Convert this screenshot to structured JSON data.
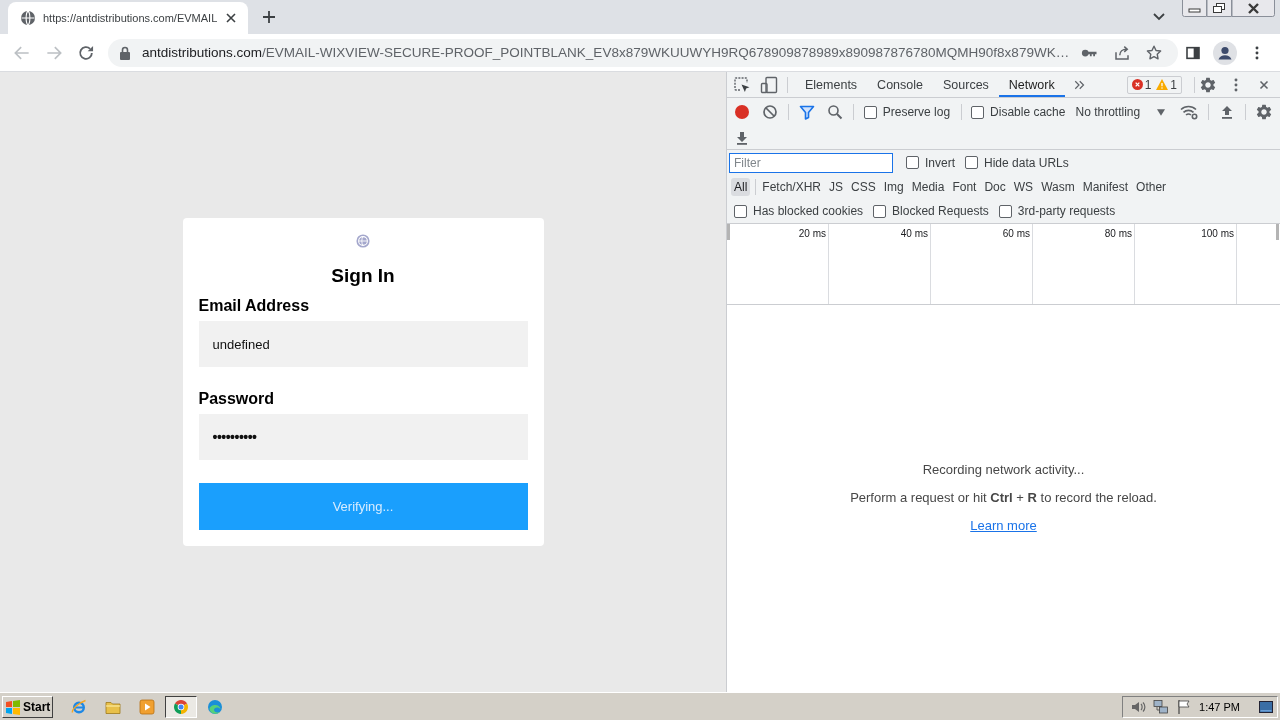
{
  "browser": {
    "tab": {
      "title": "https://antdistributions.com/EVMAIL"
    },
    "address_bar": {
      "domain": "antdistributions.com",
      "path": "/EVMAIL-WIXVIEW-SECURE-PROOF_POINTBLANK_EV8x879WKUUWYH9RQ678909878989x890987876780MQMH90f8x879WK…"
    }
  },
  "page": {
    "title": "Sign In",
    "fields": [
      {
        "label": "Email Address",
        "value": "undefined"
      },
      {
        "label": "Password",
        "value": "••••••••••"
      }
    ],
    "button": "Verifying..."
  },
  "devtools": {
    "panel_tabs": [
      {
        "label": "Elements",
        "selected": false
      },
      {
        "label": "Console",
        "selected": false
      },
      {
        "label": "Sources",
        "selected": false
      },
      {
        "label": "Network",
        "selected": true
      }
    ],
    "issues": {
      "errors": "1",
      "warnings": "1"
    },
    "toolbar": {
      "recording": true,
      "preserve_log": {
        "label": "Preserve log",
        "checked": false
      },
      "disable_cache": {
        "label": "Disable cache",
        "checked": false
      },
      "throttling": "No throttling"
    },
    "filter": {
      "placeholder": "Filter"
    },
    "filter_options": [
      {
        "label": "Invert",
        "checked": false
      },
      {
        "label": "Hide data URLs",
        "checked": false
      }
    ],
    "type_filters": [
      {
        "label": "All",
        "selected": true
      },
      {
        "label": "Fetch/XHR",
        "selected": false
      },
      {
        "label": "JS",
        "selected": false
      },
      {
        "label": "CSS",
        "selected": false
      },
      {
        "label": "Img",
        "selected": false
      },
      {
        "label": "Media",
        "selected": false
      },
      {
        "label": "Font",
        "selected": false
      },
      {
        "label": "Doc",
        "selected": false
      },
      {
        "label": "WS",
        "selected": false
      },
      {
        "label": "Wasm",
        "selected": false
      },
      {
        "label": "Manifest",
        "selected": false
      },
      {
        "label": "Other",
        "selected": false
      }
    ],
    "request_filters": [
      {
        "label": "Has blocked cookies",
        "checked": false
      },
      {
        "label": "Blocked Requests",
        "checked": false
      },
      {
        "label": "3rd-party requests",
        "checked": false
      }
    ],
    "timeline": {
      "ticks": [
        "20 ms",
        "40 ms",
        "60 ms",
        "80 ms",
        "100 ms"
      ]
    },
    "empty_state": {
      "title": "Recording network activity...",
      "hint": "Perform a request or hit **Ctrl** + **R** to record the reload.",
      "link": "Learn more"
    }
  },
  "taskbar": {
    "start": "Start",
    "apps": [
      {
        "kind": "orbit",
        "selected": false
      },
      {
        "kind": "folder",
        "selected": false
      },
      {
        "kind": "play",
        "selected": false
      },
      {
        "kind": "segmented",
        "selected": true
      },
      {
        "kind": "wave",
        "selected": false
      }
    ],
    "clock": "1:47 PM"
  }
}
